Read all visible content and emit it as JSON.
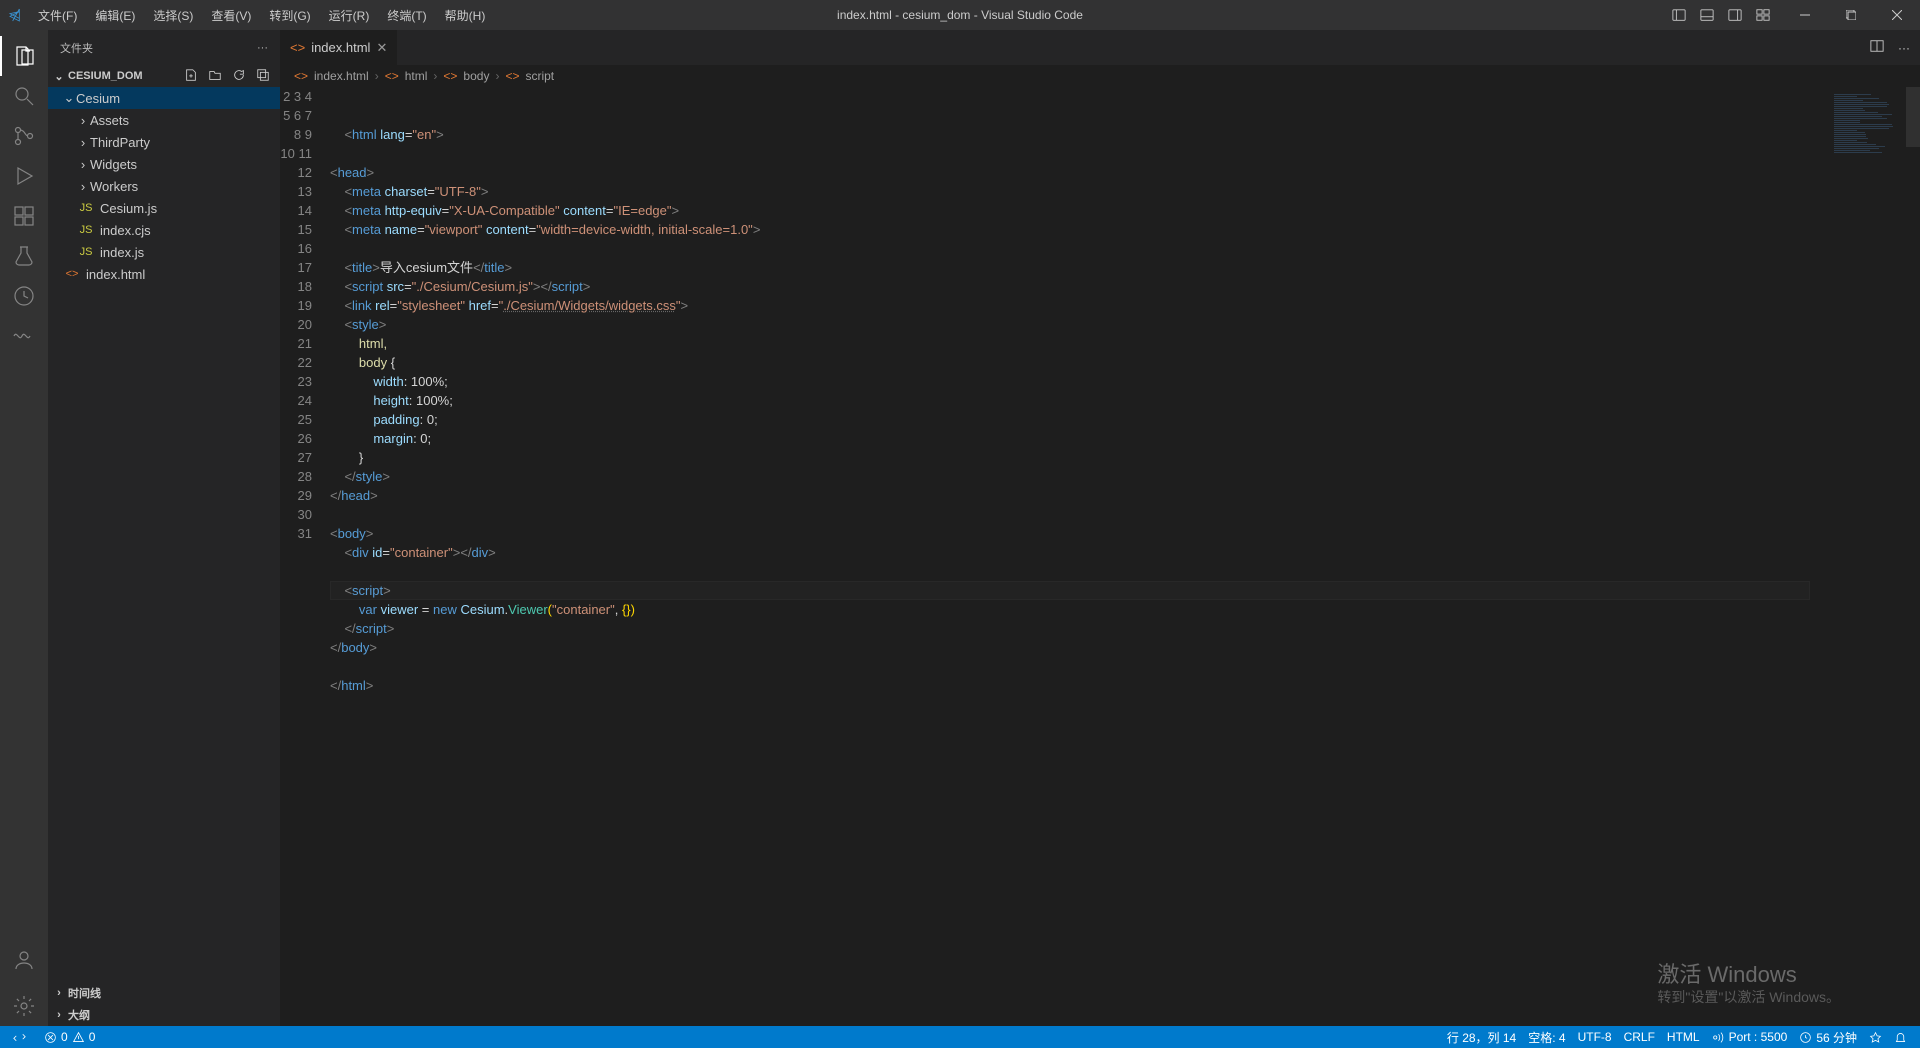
{
  "window_title": "index.html - cesium_dom - Visual Studio Code",
  "menu": {
    "file": "文件(F)",
    "edit": "编辑(E)",
    "select": "选择(S)",
    "view": "查看(V)",
    "goto": "转到(G)",
    "run": "运行(R)",
    "terminal": "终端(T)",
    "help": "帮助(H)"
  },
  "sidebar": {
    "title": "文件夹",
    "root": "CESIUM_DOM",
    "folder": "Cesium",
    "items": [
      "Assets",
      "ThirdParty",
      "Widgets",
      "Workers"
    ],
    "files": [
      "Cesium.js",
      "index.cjs",
      "index.js"
    ],
    "rootfile": "index.html",
    "timeline": "时间线",
    "outline": "大纲"
  },
  "tab": {
    "name": "index.html"
  },
  "breadcrumb": [
    "index.html",
    "html",
    "body",
    "script"
  ],
  "lines": {
    "start": 2,
    "end": 31
  },
  "code": {
    "l2": {
      "tag": "html",
      "attr": " lang",
      "val": "\"en\""
    },
    "l4": "head",
    "l5": {
      "tag": "meta",
      "a1": " charset",
      "v1": "\"UTF-8\""
    },
    "l6": {
      "tag": "meta",
      "a1": " http-equiv",
      "v1": "\"X-UA-Compatible\"",
      "a2": " content",
      "v2": "\"IE=edge\""
    },
    "l7": {
      "tag": "meta",
      "a1": " name",
      "v1": "\"viewport\"",
      "a2": " content",
      "v2": "\"width=device-width, initial-scale=1.0\""
    },
    "l9": {
      "open": "title",
      "text": "导入cesium文件",
      "close": "title"
    },
    "l10": {
      "tag": "script",
      "a1": " src",
      "v1": "\"./Cesium/Cesium.js\"",
      "close": "script"
    },
    "l11": {
      "tag": "link",
      "a1": " rel",
      "v1": "\"stylesheet\"",
      "a2": " href",
      "v2": "\"",
      "link": "./Cesium/Widgets/widgets.css",
      "v2e": "\""
    },
    "l12": "style",
    "l13": "        html,",
    "l14": {
      "sel": "        body",
      "brace": " {"
    },
    "l15": {
      "p": "            width",
      "v": ": 100%;"
    },
    "l16": {
      "p": "            height",
      "v": ": 100%;"
    },
    "l17": {
      "p": "            padding",
      "v": ": 0;"
    },
    "l18": {
      "p": "            margin",
      "v": ": 0;"
    },
    "l19": "        }",
    "l20": "style",
    "l21": "head",
    "l23": "body",
    "l24": {
      "tag": "div",
      "a1": " id",
      "v1": "\"container\"",
      "close": "div"
    },
    "l26": "script",
    "l27": {
      "kw": "        var",
      "var": " viewer",
      "eq": " = ",
      "new": "new",
      "ns": " Cesium",
      "dot": ".",
      "cls": "Viewer",
      "p1": "(",
      "s": "\"container\"",
      "c": ", ",
      "b1": "{",
      "b2": "}",
      "p2": ")"
    },
    "l28": "script",
    "l29": "body",
    "l31": "html"
  },
  "status": {
    "remote": "",
    "errors": "0",
    "warnings": "0",
    "pos": "行 28，列 14",
    "spaces": "空格: 4",
    "enc": "UTF-8",
    "eol": "CRLF",
    "lang": "HTML",
    "port": "Port : 5500",
    "timer": "56 分钟",
    "feedback": "",
    "bell": ""
  },
  "watermark": {
    "title": "激活 Windows",
    "sub": "转到\"设置\"以激活 Windows。"
  }
}
